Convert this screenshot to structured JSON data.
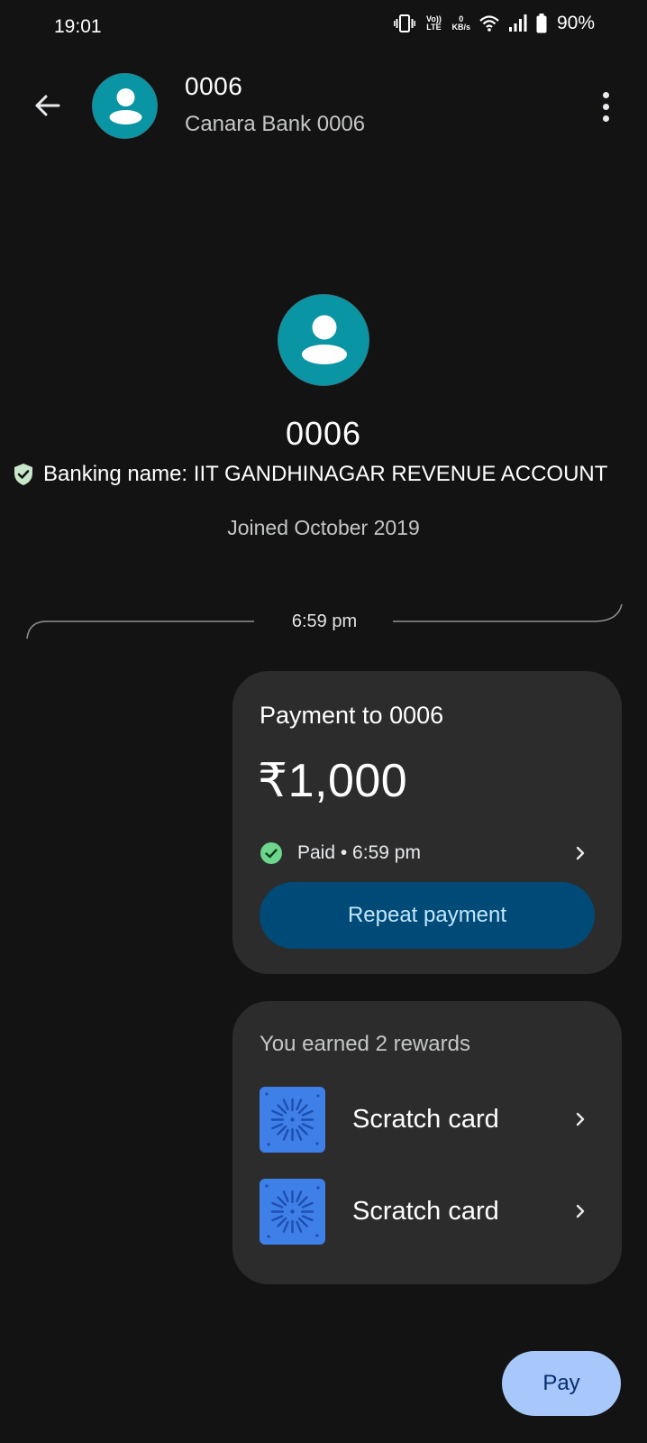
{
  "status_bar": {
    "time": "19:01",
    "network_label": "Vo)) LTE",
    "data_speed_value": "0",
    "data_speed_unit": "KB/s",
    "battery": "90%",
    "icons": [
      "vibrate-icon",
      "volte-icon",
      "data-speed-icon",
      "wifi-icon",
      "signal-icon",
      "battery-icon"
    ]
  },
  "header": {
    "title": "0006",
    "subtitle": "Canara Bank 0006"
  },
  "profile": {
    "name": "0006",
    "banking_name": "Banking name: IIT GANDHINAGAR REVENUE ACCOUNT",
    "joined": "Joined October 2019"
  },
  "conversation": {
    "time_divider": "6:59 pm"
  },
  "payment_card": {
    "title": "Payment to 0006",
    "amount": "₹1,000",
    "status": "Paid • 6:59 pm",
    "repeat_label": "Repeat payment"
  },
  "rewards_card": {
    "title": "You earned 2 rewards",
    "items": [
      {
        "label": "Scratch card"
      },
      {
        "label": "Scratch card"
      }
    ]
  },
  "fab": {
    "label": "Pay"
  },
  "colors": {
    "background": "#131313",
    "card": "#2c2c2c",
    "avatar": "#0a95a4",
    "repeat_button": "#004a77",
    "repeat_text": "#c2e7ff",
    "fab": "#a8c7fa",
    "fab_text": "#062e6f",
    "paid_green": "#6dd58c",
    "scratch_blue": "#3f7fe8"
  }
}
